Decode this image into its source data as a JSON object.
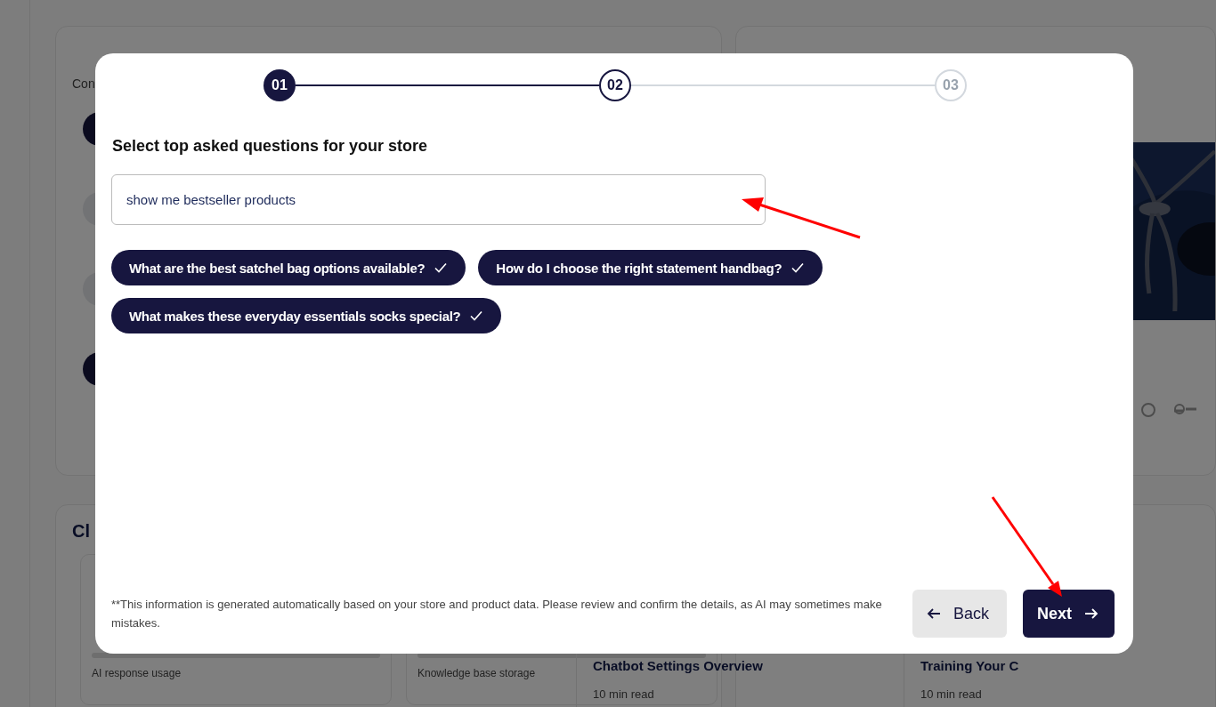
{
  "background": {
    "checklist_card": {
      "subtitle": "Con"
    },
    "usage_card": {
      "title": "Cl",
      "meters": [
        {
          "label": "AI response usage"
        },
        {
          "label": "Knowledge base storage"
        }
      ]
    },
    "articles": [
      {
        "title": "Chatbot Settings Overview",
        "meta": "10 min read"
      },
      {
        "title": "Training Your C",
        "meta": "10 min read"
      }
    ]
  },
  "modal": {
    "steps": [
      {
        "label": "01",
        "done": true,
        "current": false
      },
      {
        "label": "02",
        "done": false,
        "current": true
      },
      {
        "label": "03",
        "done": false,
        "current": false
      }
    ],
    "heading": "Select top asked questions for your store",
    "question_field": {
      "value": "show me bestseller products"
    },
    "questions": [
      {
        "text": "What are the best satchel bag options available?",
        "selected": true
      },
      {
        "text": "How do I choose the right statement handbag?",
        "selected": true
      },
      {
        "text": "What makes these everyday essentials socks special?",
        "selected": true
      }
    ],
    "note": "**This information is generated automatically based on your store and product data. Please review and confirm the details, as AI may sometimes make mistakes.",
    "buttons": [
      {
        "label": "Back",
        "kind": "back"
      },
      {
        "label": "Next",
        "kind": "next"
      }
    ]
  }
}
